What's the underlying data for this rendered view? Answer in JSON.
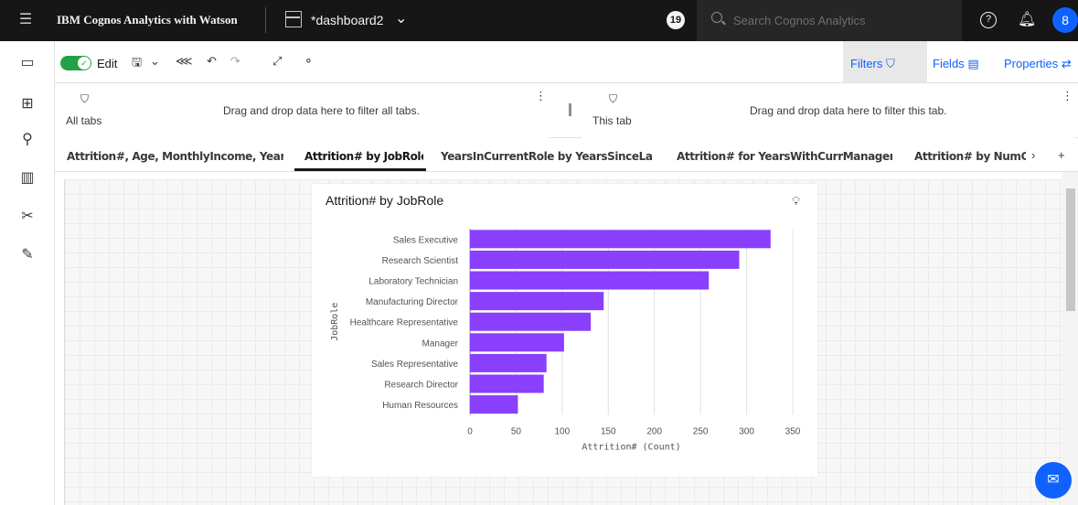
{
  "topbar": {
    "app_title": "IBM Cognos Analytics with Watson",
    "dashboard_name": "*dashboard2",
    "badge_count": "19",
    "search_placeholder": "Search Cognos Analytics",
    "help_glyph": "?",
    "avatar_glyph": "8",
    "icons": [
      "menu-icon",
      "dashboard-icon",
      "chevron-down-icon",
      "search-icon",
      "help-icon",
      "bell-icon",
      "user-avatar-icon"
    ]
  },
  "leftrail": {
    "icons": [
      "chat-icon",
      "data-source-icon",
      "pin-icon",
      "visualization-icon",
      "tools-icon",
      "assistant-icon"
    ]
  },
  "toolbar": {
    "edit_label": "Edit",
    "edit_enabled": true,
    "filters_label": "Filters",
    "fields_label": "Fields",
    "properties_label": "Properties"
  },
  "filters": {
    "all_tabs_label": "All tabs",
    "all_tabs_hint": "Drag and drop data here to filter all tabs.",
    "this_tab_label": "This tab",
    "this_tab_hint": "Drag and drop data here to filter this tab."
  },
  "tabs": [
    {
      "label": "Attrition#, Age, MonthlyIncome, YearsAtC",
      "active": false
    },
    {
      "label": "Attrition# by JobRole",
      "active": true
    },
    {
      "label": "YearsInCurrentRole by YearsSinceLastPro",
      "active": false
    },
    {
      "label": "Attrition# for YearsWithCurrManager hier",
      "active": false
    },
    {
      "label": "Attrition# by NumCo",
      "active": false
    }
  ],
  "widget": {
    "title": "Attrition# by JobRole"
  },
  "chart_data": {
    "type": "bar",
    "orientation": "horizontal",
    "title": "Attrition# by JobRole",
    "xlabel": "Attrition# (Count)",
    "ylabel": "JobRole",
    "categories": [
      "Sales Executive",
      "Research Scientist",
      "Laboratory Technician",
      "Manufacturing Director",
      "Healthcare Representative",
      "Manager",
      "Sales Representative",
      "Research Director",
      "Human Resources"
    ],
    "values": [
      326,
      292,
      259,
      145,
      131,
      102,
      83,
      80,
      52
    ],
    "xlim": [
      0,
      350
    ],
    "xticks": [
      0,
      50,
      100,
      150,
      200,
      250,
      300,
      350
    ],
    "grid": true,
    "bar_color": "#8a3ffc"
  },
  "colors": {
    "topbar_bg": "#161616",
    "accent_blue": "#0f62fe",
    "toggle_green": "#24a148"
  }
}
